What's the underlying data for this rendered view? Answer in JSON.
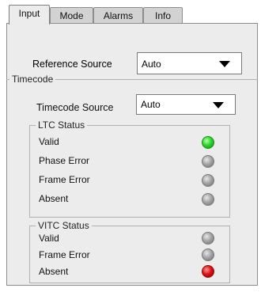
{
  "tabs": [
    {
      "label": "Input",
      "active": true
    },
    {
      "label": "Mode",
      "active": false
    },
    {
      "label": "Alarms",
      "active": false
    },
    {
      "label": "Info",
      "active": false
    }
  ],
  "reference": {
    "label": "Reference Source",
    "value": "Auto"
  },
  "timecode": {
    "legend": "Timecode",
    "source_label": "Timecode Source",
    "source_value": "Auto",
    "ltc": {
      "legend": "LTC Status",
      "rows": [
        {
          "label": "Valid",
          "status": "green"
        },
        {
          "label": "Phase Error",
          "status": "gray"
        },
        {
          "label": "Frame Error",
          "status": "gray"
        },
        {
          "label": "Absent",
          "status": "gray"
        }
      ]
    },
    "vitc": {
      "legend": "VITC Status",
      "rows": [
        {
          "label": "Valid",
          "status": "gray"
        },
        {
          "label": "Frame Error",
          "status": "gray"
        },
        {
          "label": "Absent",
          "status": "red"
        }
      ]
    }
  },
  "colors": {
    "panel": "#ececec",
    "ok": "#2fd52a",
    "alarm": "#e01010",
    "off": "#a6a6a6"
  }
}
